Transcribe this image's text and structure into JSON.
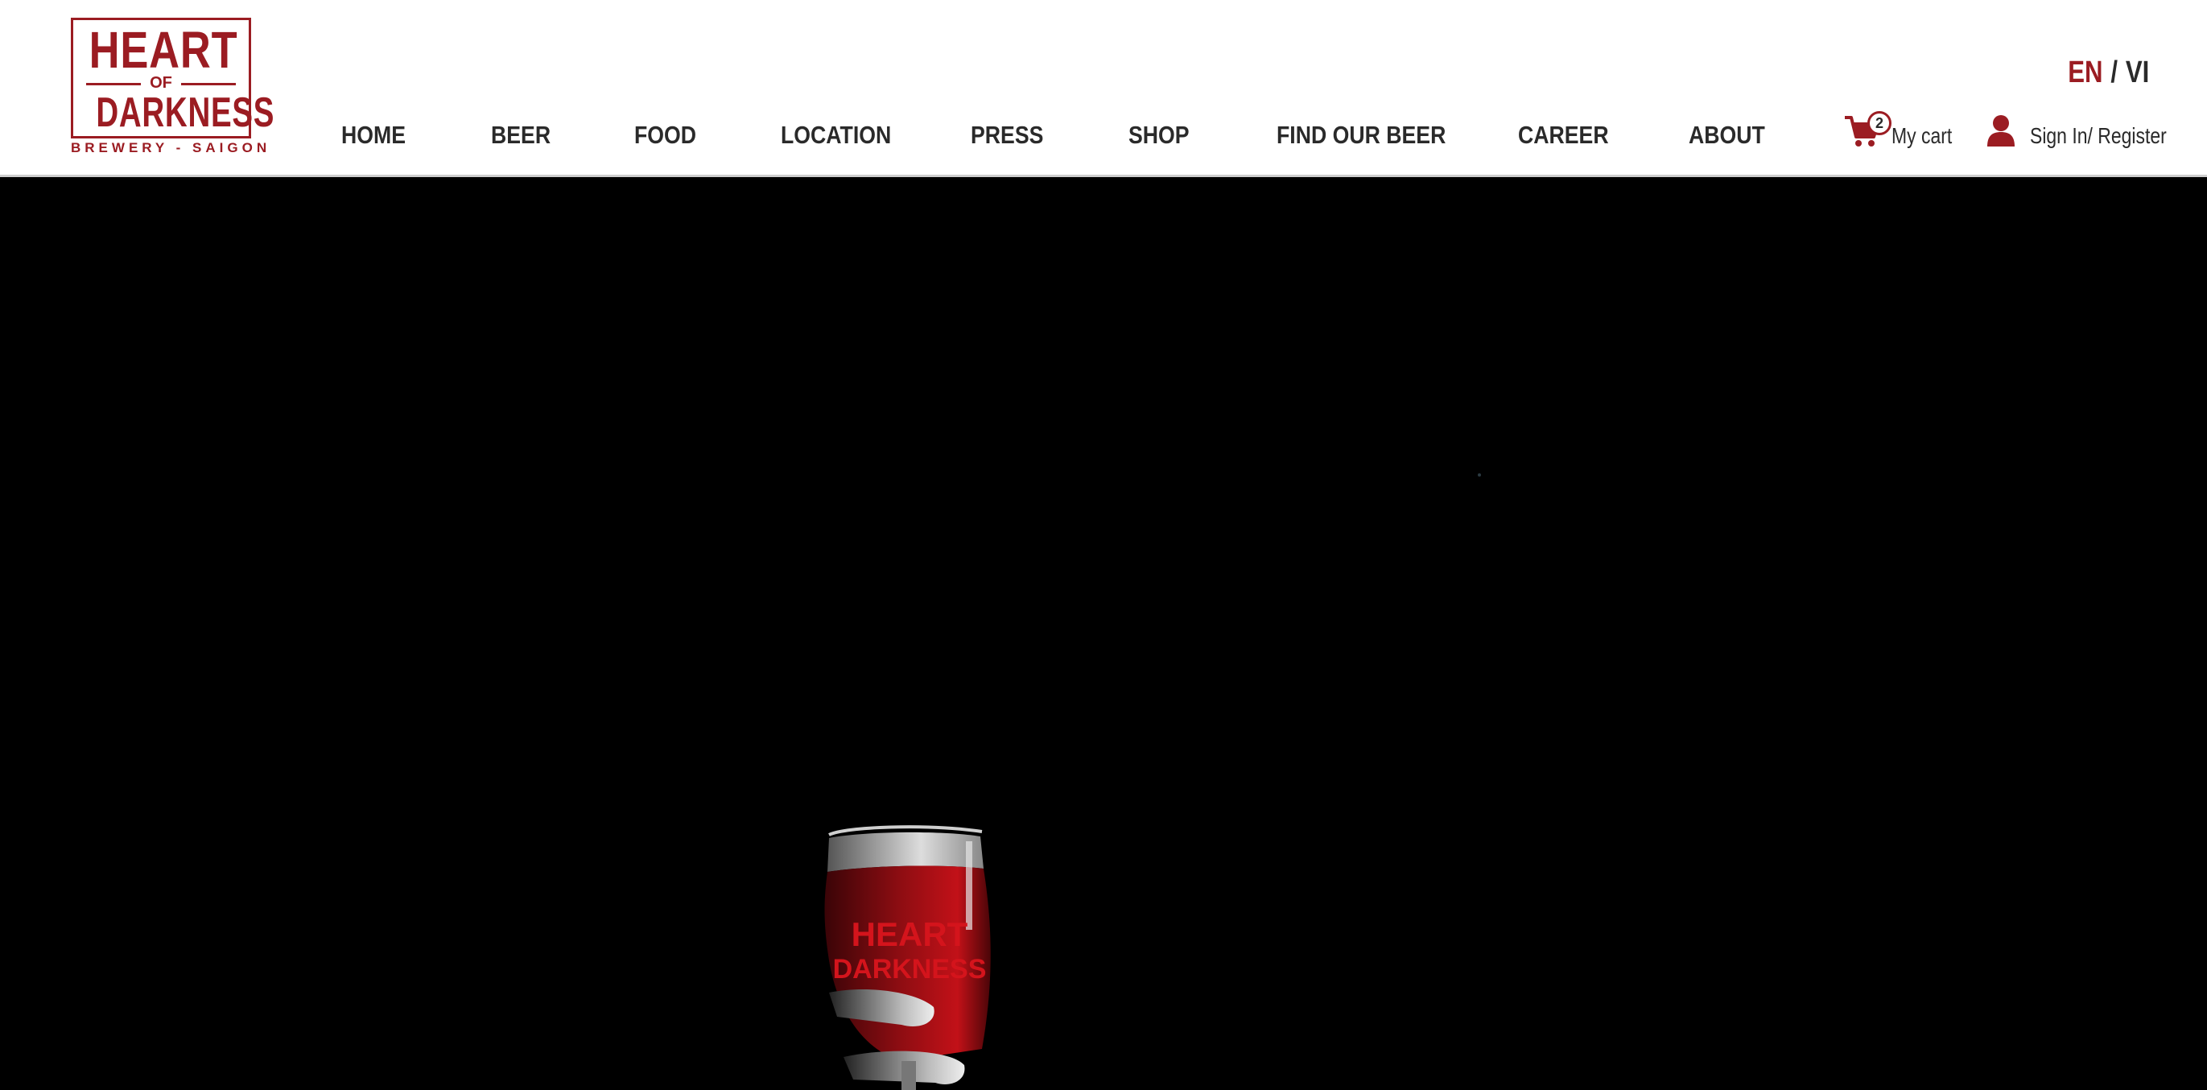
{
  "logo": {
    "line1": "HEART",
    "line2": "OF",
    "line3": "DARKNESS",
    "tagline": "BREWERY - SAIGON",
    "glass_logo_line1": "HEART",
    "glass_logo_line2": "DARKNESS"
  },
  "nav": {
    "items": [
      {
        "label": "HOME"
      },
      {
        "label": "BEER"
      },
      {
        "label": "FOOD"
      },
      {
        "label": "LOCATION"
      },
      {
        "label": "PRESS"
      },
      {
        "label": "SHOP"
      },
      {
        "label": "FIND OUR BEER"
      },
      {
        "label": "CAREER"
      },
      {
        "label": "ABOUT"
      }
    ]
  },
  "language": {
    "active": "EN",
    "separator": "/",
    "other": "VI"
  },
  "cart": {
    "count": "2",
    "label": "My cart",
    "icon": "cart-icon"
  },
  "account": {
    "label": "Sign In/ Register",
    "icon": "user-icon"
  },
  "colors": {
    "brand": "#9b1c22",
    "text": "#2a2a2a",
    "hero_bg": "#000000"
  }
}
